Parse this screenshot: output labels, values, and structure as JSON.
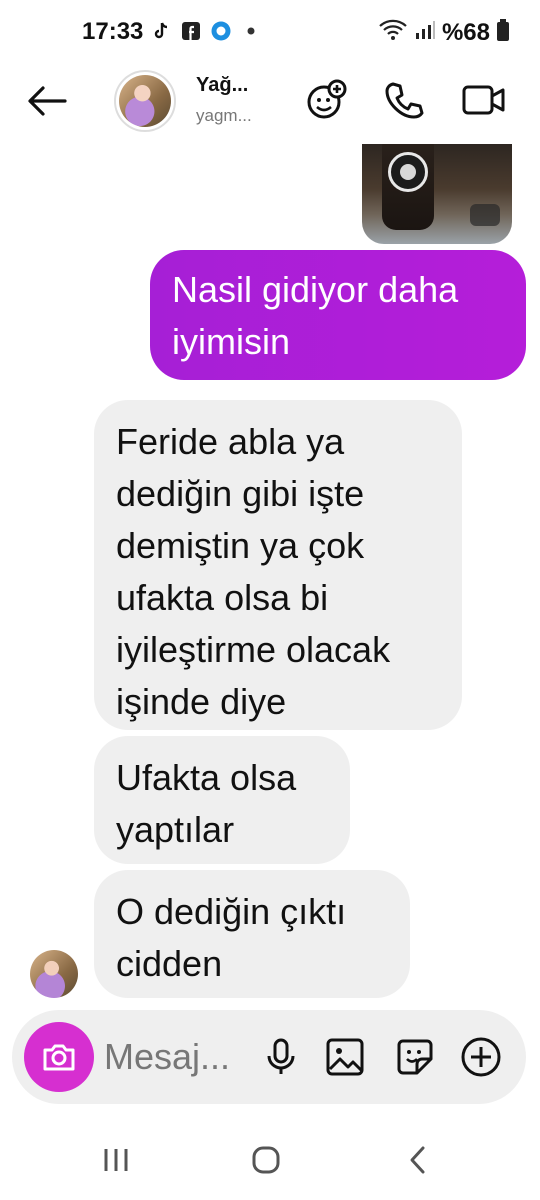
{
  "status_bar": {
    "time": "17:33",
    "battery": "%68",
    "left_icons": [
      "tiktok-icon",
      "facebook-icon",
      "pinned-app-icon",
      "dot-icon"
    ],
    "right_icons": [
      "wifi-icon",
      "signal-icon",
      "battery-icon"
    ]
  },
  "header": {
    "name": "Yağ...",
    "username": "yagm...",
    "actions": [
      "add-person-icon",
      "phone-icon",
      "video-icon"
    ]
  },
  "messages": {
    "sent_text": "Nasil gidiyor daha iyimisin",
    "received": [
      "Feride abla ya dediğin gibi işte demiştin ya çok ufakta olsa bi iyileştirme olacak işinde diye",
      "Ufakta olsa yaptılar",
      "O dediğin çıktı cidden"
    ]
  },
  "composer": {
    "placeholder": "Mesaj..."
  },
  "colors": {
    "sent_bubble": "#b01edb",
    "received_bubble": "#efefef",
    "camera_button": "#d62fd0"
  }
}
